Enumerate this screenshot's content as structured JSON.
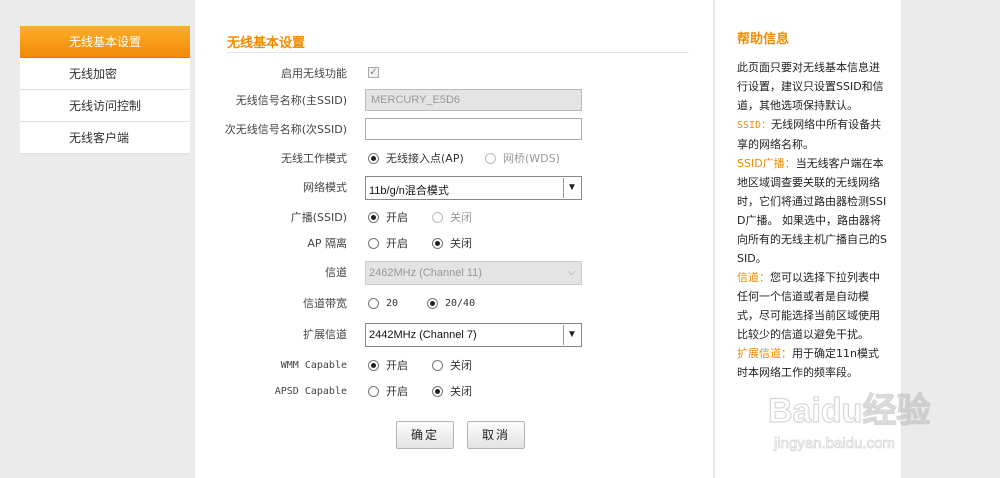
{
  "sidebar": {
    "items": [
      {
        "label": "无线基本设置",
        "active": true
      },
      {
        "label": "无线加密",
        "active": false
      },
      {
        "label": "无线访问控制",
        "active": false
      },
      {
        "label": "无线客户端",
        "active": false
      }
    ]
  },
  "main": {
    "title": "无线基本设置",
    "enable_wireless": {
      "label": "启用无线功能",
      "checked": true
    },
    "ssid_primary": {
      "label": "无线信号名称(主SSID)",
      "value": "MERCURY_E5D6"
    },
    "ssid_secondary": {
      "label": "次无线信号名称(次SSID)",
      "value": ""
    },
    "work_mode": {
      "label": "无线工作模式",
      "option_ap": "无线接入点(AP)",
      "option_wds": "网桥(WDS)"
    },
    "network_mode": {
      "label": "网络模式",
      "value": "11b/g/n混合模式"
    },
    "broadcast": {
      "label": "广播(SSID)",
      "on": "开启",
      "off": "关闭"
    },
    "ap_isolation": {
      "label": "AP 隔离",
      "on": "开启",
      "off": "关闭"
    },
    "channel": {
      "label": "信道",
      "value": "2462MHz (Channel 11)"
    },
    "bandwidth": {
      "label": "信道带宽",
      "option_20": "20",
      "option_2040": "20/40"
    },
    "ext_channel": {
      "label": "扩展信道",
      "value": "2442MHz (Channel 7)"
    },
    "wmm": {
      "label": "WMM Capable",
      "on": "开启",
      "off": "关闭"
    },
    "apsd": {
      "label": "APSD Capable",
      "on": "开启",
      "off": "关闭"
    },
    "buttons": {
      "ok": "确定",
      "cancel": "取消"
    }
  },
  "help": {
    "title": "帮助信息",
    "intro": "此页面只要对无线基本信息进行设置，建议只设置SSID和信道，其他选项保持默认。",
    "ssid_key": "SSID：",
    "ssid_text": "无线网络中所有设备共享的网络名称。",
    "broadcast_key": "SSID广播：",
    "broadcast_text": "当无线客户端在本地区域调查要关联的无线网络时，它们将通过路由器检测SSID广播。 如果选中，路由器将向所有的无线主机广播自己的SSID。",
    "channel_key": "信道：",
    "channel_text": "您可以选择下拉列表中任何一个信道或者是自动模式，尽可能选择当前区域使用比较少的信道以避免干扰。",
    "ext_key": "扩展信道：",
    "ext_text": "用于确定11n模式时本网络工作的频率段。"
  },
  "watermark": {
    "brand": "Baidu经验",
    "url": "jingyan.baidu.com"
  },
  "colors": {
    "accent": "#f08c00",
    "nav_active": "#f7a11a"
  }
}
